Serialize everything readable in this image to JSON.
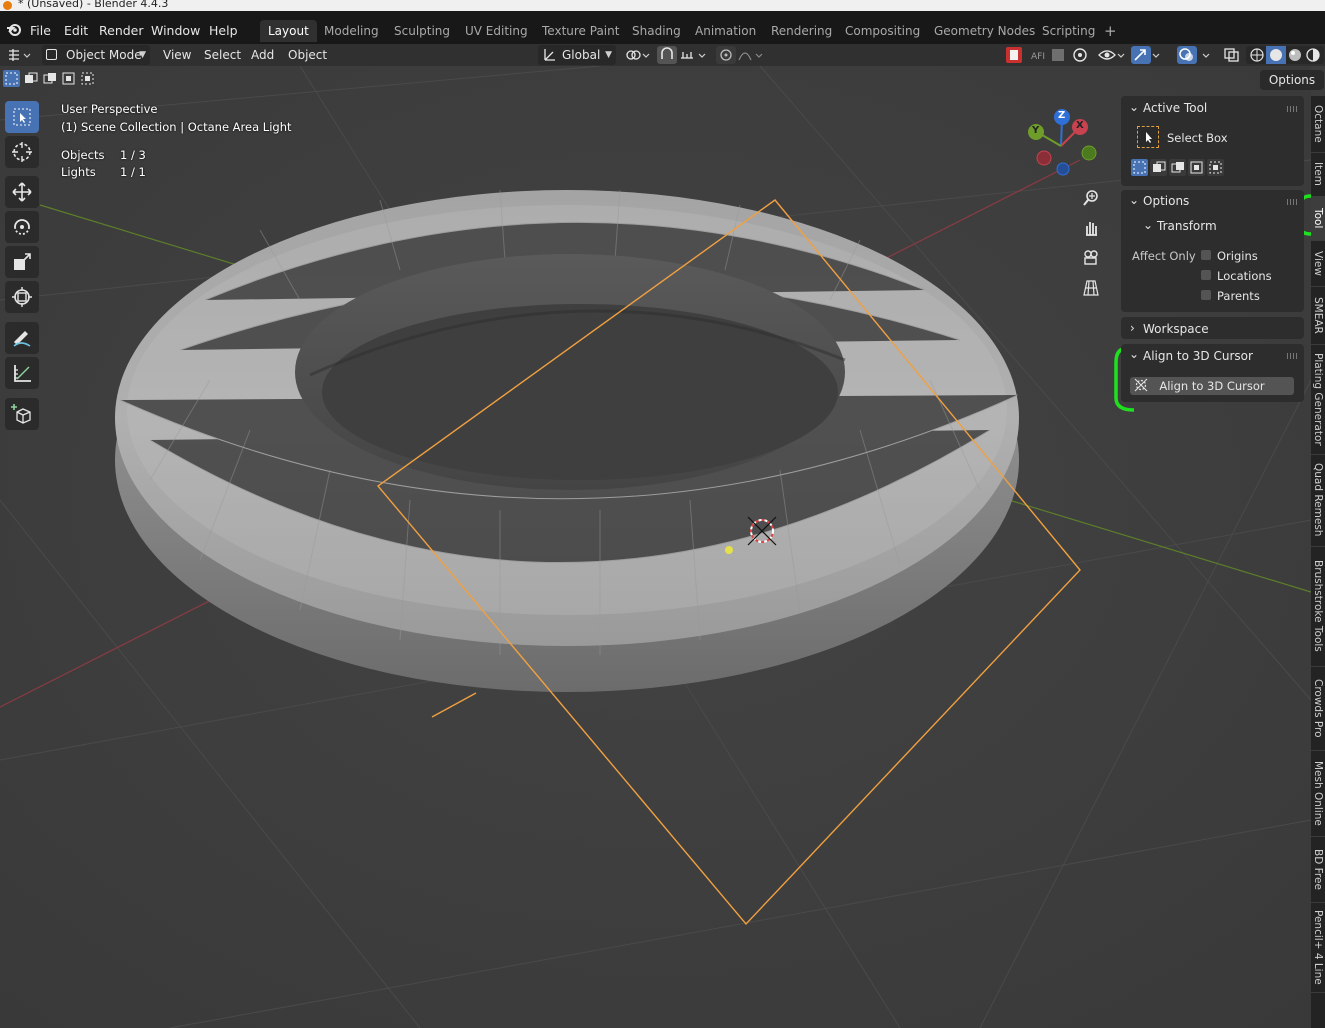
{
  "window": {
    "title": "* (Unsaved) - Blender 4.4.3"
  },
  "menu": {
    "items": [
      "File",
      "Edit",
      "Render",
      "Window",
      "Help"
    ]
  },
  "workspaces": {
    "tabs": [
      "Layout",
      "Modeling",
      "Sculpting",
      "UV Editing",
      "Texture Paint",
      "Shading",
      "Animation",
      "Rendering",
      "Compositing",
      "Geometry Nodes",
      "Scripting"
    ],
    "active": "Layout",
    "add_label": "+"
  },
  "header": {
    "mode": "Object Mode",
    "menus": [
      "View",
      "Select",
      "Add",
      "Object"
    ],
    "orientation": "Global",
    "options_label": "Options"
  },
  "viewport": {
    "perspective": "User Perspective",
    "collection": "(1) Scene Collection | Octane Area Light",
    "stats": [
      {
        "label": "Objects",
        "value": "1 / 3"
      },
      {
        "label": "Lights",
        "value": "1 / 1"
      }
    ],
    "gizmo": {
      "z": "Z",
      "y": "Y",
      "x": "X"
    }
  },
  "npanel": {
    "active_tool": {
      "title": "Active Tool",
      "tool_name": "Select Box"
    },
    "options": {
      "title": "Options",
      "transform": "Transform",
      "affect_only": "Affect Only",
      "checks": [
        "Origins",
        "Locations",
        "Parents"
      ]
    },
    "workspace": {
      "title": "Workspace"
    },
    "align": {
      "title": "Align to 3D Cursor",
      "button": "Align to 3D Cursor"
    }
  },
  "sidebar_tabs": [
    "Octane",
    "Item",
    "Tool",
    "View",
    "SMEAR",
    "Plating Generator",
    "Quad Remesh",
    "Brushstroke Tools",
    "Crowds Pro",
    "Mesh Online",
    "BD Free",
    "Pencil+ 4 Line"
  ],
  "active_sidebar_tab": "Tool",
  "colors": {
    "accent": "#4772b3",
    "selection_orange": "#f0a040",
    "annotation_green": "#1fe01f",
    "axis_x": "#c8424f",
    "axis_y": "#6e9d2a",
    "axis_z": "#2f6fd8"
  }
}
